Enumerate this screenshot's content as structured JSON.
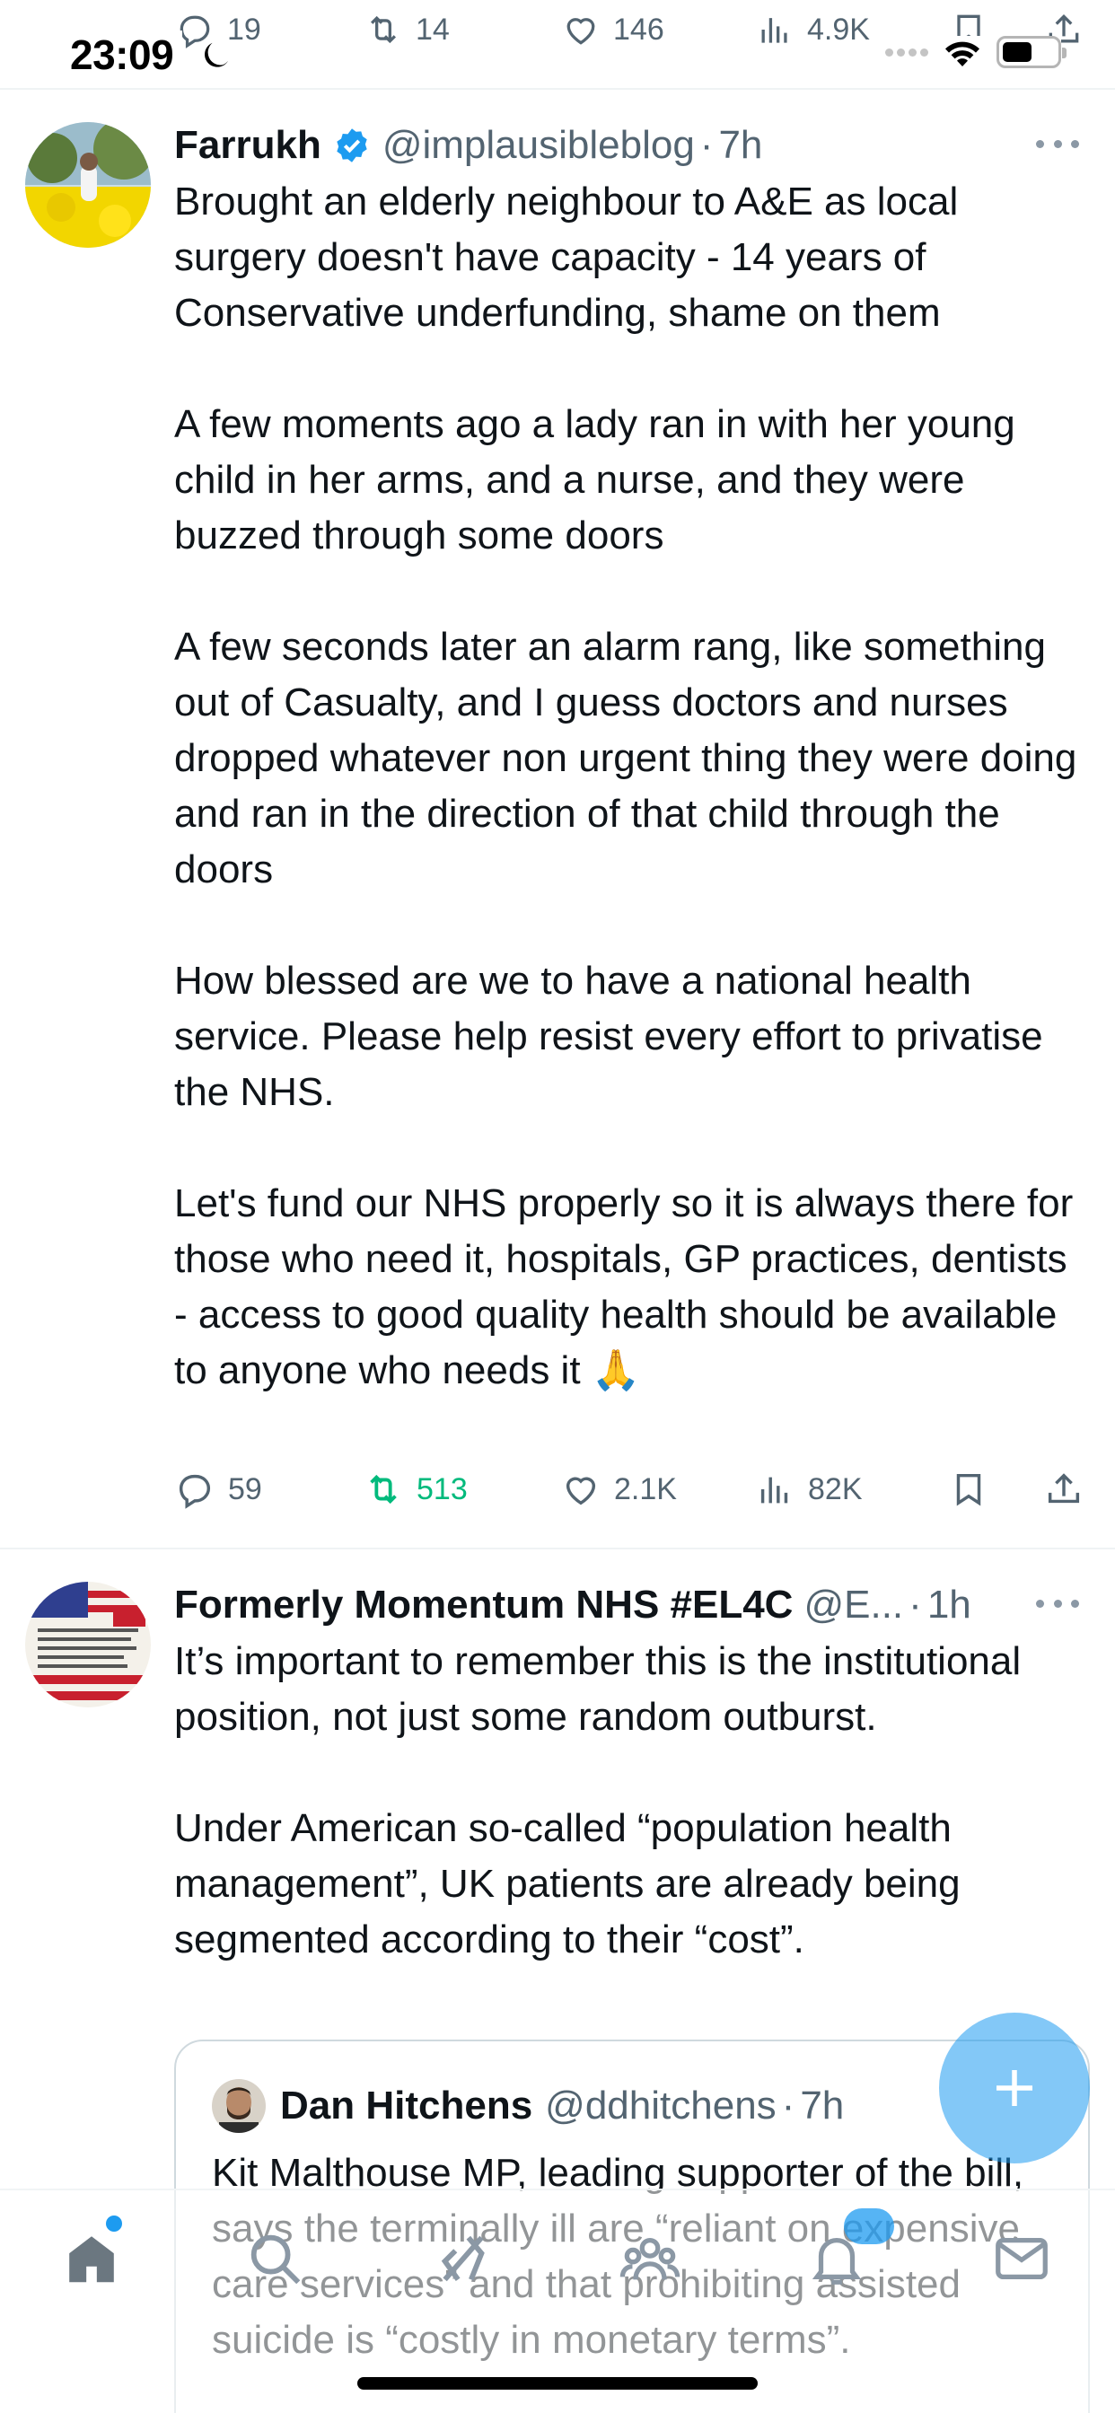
{
  "status_bar": {
    "time": "23:09",
    "top_actions": {
      "replies": "19",
      "reposts": "14",
      "likes": "146",
      "views": "4.9K"
    }
  },
  "tweet1": {
    "display_name": "Farrukh",
    "handle": "@implausibleblog",
    "separator": "·",
    "time": "7h",
    "text": "Brought an elderly neighbour to A&E as local surgery doesn't have capacity - 14 years of Conservative underfunding, shame on them\n\nA few moments ago a lady ran in with her young child in her arms, and a nurse, and they were buzzed through some doors\n\nA few seconds later an alarm rang, like something out of Casualty, and I guess doctors and nurses dropped whatever non urgent thing they were doing and ran in the direction of that child through the doors\n\nHow blessed are we to have a national health service. Please help resist every effort to privatise the NHS.\n\nLet's fund our NHS properly so it is always there for those who need it, hospitals, GP practices, dentists - access to good quality health should be available to anyone who needs it 🙏",
    "actions": {
      "replies": "59",
      "reposts": "513",
      "likes": "2.1K",
      "views": "82K"
    },
    "repost_color": "#00ba7c"
  },
  "tweet2": {
    "display_name": "Formerly Momentum NHS #EL4C",
    "handle": "@E...",
    "separator": "·",
    "time": "1h",
    "text": "It’s important to remember this is the institutional position, not just some random outburst.\n\nUnder American so-called “population health management”, UK patients are already being segmented according to their “cost”.",
    "quote": {
      "display_name": "Dan Hitchens",
      "handle": "@ddhitchens",
      "separator": "·",
      "time": "7h",
      "text": "Kit Malthouse MP, leading supporter of the bill, says the terminally ill are “reliant on expensive care services” and that prohibiting assisted suicide is “costly in monetary terms”."
    }
  },
  "colors": {
    "accent": "#1d9bf0",
    "secondary_text": "#536471",
    "divider": "#eff3f4"
  },
  "icons": {
    "reply": "reply-icon",
    "repost": "repost-icon",
    "like": "like-icon",
    "views": "views-icon",
    "bookmark": "bookmark-icon",
    "share": "share-icon",
    "compose": "plus-icon",
    "nav": [
      "home-icon",
      "search-icon",
      "grok-icon",
      "communities-icon",
      "notifications-icon",
      "messages-icon"
    ]
  }
}
